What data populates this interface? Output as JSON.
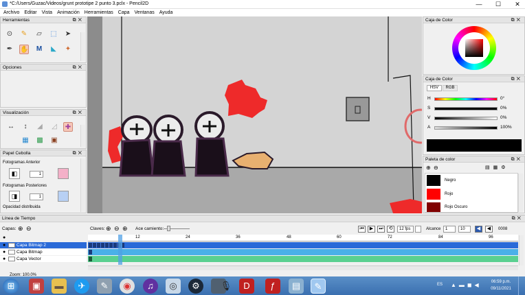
{
  "window": {
    "title": "*C:/Users/Guzac/Videos/grunt prototipe 2 punto 3.pclx - Pencil2D",
    "controls": [
      "—",
      "☐",
      "✕"
    ]
  },
  "menu": [
    "Archivo",
    "Editar",
    "Vista",
    "Animación",
    "Herramientas",
    "Capa",
    "Ventanas",
    "Ayuda"
  ],
  "panels": {
    "tools": {
      "title": "Herramientas"
    },
    "options": {
      "title": "Opciones"
    },
    "display": {
      "title": "Visualización"
    },
    "onion": {
      "title": "Papel Cebolla",
      "prev_label": "Fotogramas Anterior",
      "prev_value": "1",
      "next_label": "Fotogramas Posteriores",
      "next_value": "1",
      "opacity_label": "Opacidad distribuida"
    },
    "color_box": {
      "title": "Caja de Color"
    },
    "color_box2": {
      "title": "Caja de Color",
      "tabs": [
        "HSV",
        "RGB"
      ],
      "sliders": [
        {
          "label": "H",
          "value": "0°"
        },
        {
          "label": "S",
          "value": "0%"
        },
        {
          "label": "V",
          "value": "0%"
        },
        {
          "label": "A",
          "value": "100%"
        }
      ]
    },
    "palette": {
      "title": "Paleta de color",
      "items": [
        {
          "name": "Negro",
          "color": "#000000"
        },
        {
          "name": "Rojo",
          "color": "#ff0000"
        },
        {
          "name": "Rojo Oscuro",
          "color": "#800000"
        }
      ]
    }
  },
  "timeline": {
    "title": "Línea de Tiempo",
    "layers_label": "Capas:",
    "keys_label": "Claves:",
    "onion_label": "Ace camiento:",
    "fps": "12 fps",
    "range_label": "Alcance",
    "range_start": "1",
    "range_end": "10",
    "frame_counter": "0008",
    "frame_ticks": [
      "12",
      "24",
      "36",
      "48",
      "60",
      "72",
      "84",
      "96"
    ],
    "layers": [
      "Capa Bitmap 2",
      "Capa Bitmap",
      "Capa Vector"
    ]
  },
  "status": {
    "zoom": "Zoom: 100.0%"
  },
  "taskbar": {
    "lang": "ES",
    "time": "06:59 p.m.",
    "date": "09/11/2021"
  }
}
